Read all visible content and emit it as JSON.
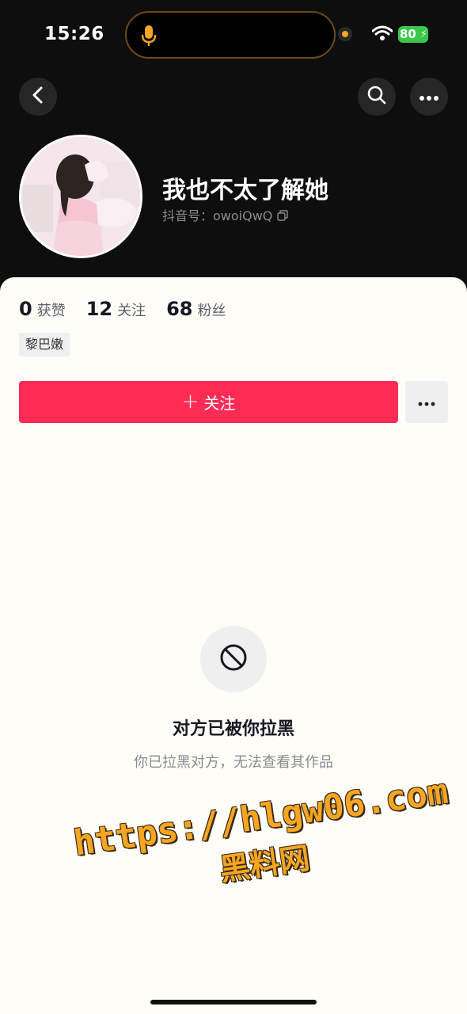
{
  "status_bar": {
    "time": "15:26",
    "battery": "80"
  },
  "header": {
    "back_icon": "chevron-left-icon",
    "search_icon": "search-icon",
    "more_icon": "more-horizontal-icon"
  },
  "profile": {
    "nickname": "我也不太了解她",
    "douyin_id": "抖音号：owoiQwQ",
    "copy_icon": "copy-icon"
  },
  "stats": [
    {
      "num": "0",
      "label": "获赞"
    },
    {
      "num": "12",
      "label": "关注"
    },
    {
      "num": "68",
      "label": "粉丝"
    }
  ],
  "tag": "黎巴嫩",
  "follow_button": {
    "plus": "+",
    "label": "关注"
  },
  "blocked": {
    "title": "对方已被你拉黑",
    "description": "你已拉黑对方，无法查看其作品",
    "icon": "blocked-icon"
  },
  "watermark": {
    "url": "https://hlgw06.com",
    "text": "黑料网"
  },
  "colors": {
    "accent": "#fe2c55",
    "dark": "#0e0e0e",
    "watermark": "#f6a623"
  }
}
